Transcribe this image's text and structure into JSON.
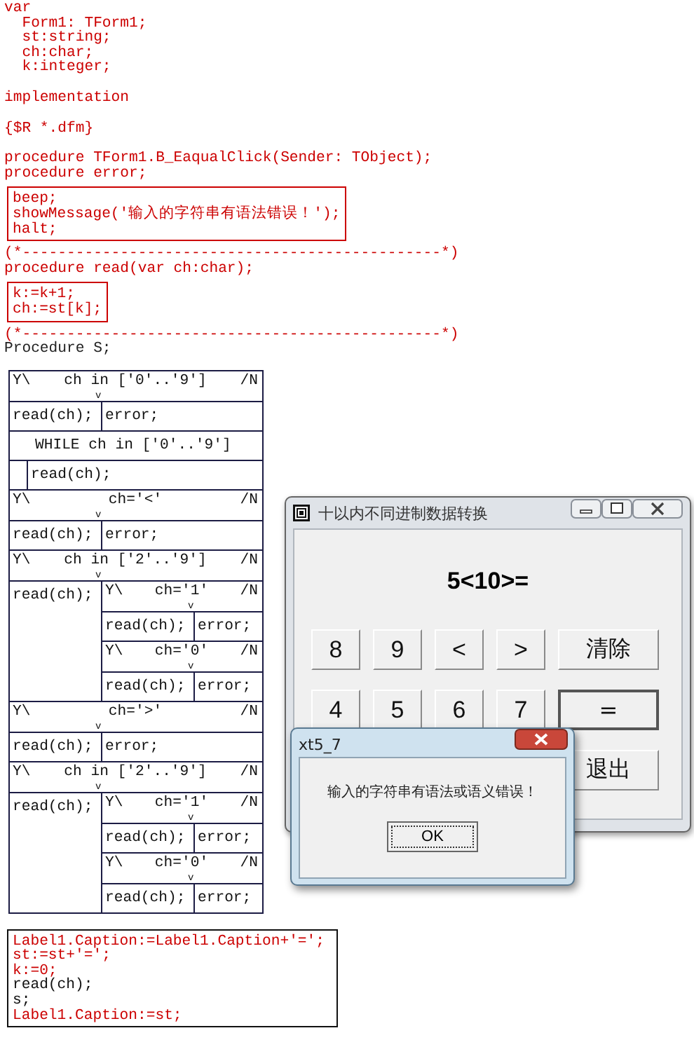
{
  "code_blocks": [
    {
      "kind": "plain",
      "lines": [
        {
          "text": "var",
          "color": "#cc0000"
        },
        {
          "text": "  Form1: TForm1;",
          "color": "#cc0000"
        },
        {
          "text": "  st:string;",
          "color": "#cc0000"
        },
        {
          "text": "  ch:char;",
          "color": "#cc0000"
        },
        {
          "text": "  k:integer;",
          "color": "#cc0000"
        }
      ]
    },
    {
      "kind": "plain",
      "lines": [
        {
          "text": "implementation",
          "color": "#cc0000"
        }
      ]
    },
    {
      "kind": "plain",
      "lines": [
        {
          "text": "{$R *.dfm}",
          "color": "#cc0000"
        }
      ]
    },
    {
      "kind": "plain",
      "lines": [
        {
          "text": "procedure TForm1.B_EaqualClick(Sender: TObject);",
          "color": "#cc0000"
        },
        {
          "text": "procedure error;",
          "color": "#cc0000"
        }
      ]
    },
    {
      "kind": "boxed",
      "color": "#cc0000",
      "lines": [
        {
          "text": "beep;",
          "color": "#cc0000"
        },
        {
          "text": "showMessage('输入的字符串有语法错误！');",
          "color": "#cc0000"
        },
        {
          "text": "halt;",
          "color": "#cc0000"
        }
      ]
    },
    {
      "kind": "plain",
      "lines": [
        {
          "text": "(*-----------------------------------------------*)",
          "color": "#cc0000"
        },
        {
          "text": "procedure read(var ch:char);",
          "color": "#cc0000"
        }
      ]
    },
    {
      "kind": "boxed",
      "color": "#cc0000",
      "lines": [
        {
          "text": "k:=k+1;",
          "color": "#cc0000"
        },
        {
          "text": "ch:=st[k];",
          "color": "#cc0000"
        }
      ]
    },
    {
      "kind": "plain",
      "lines": [
        {
          "text": "(*-----------------------------------------------*)",
          "color": "#cc0000"
        },
        {
          "text": "Procedure S;",
          "color": "#222222"
        }
      ]
    }
  ],
  "diagram": [
    {
      "kind": "if",
      "yes_label": "Y\\",
      "cond": "ch in ['0'..'9']",
      "no_label": "/N",
      "mark": "v",
      "yes": [
        {
          "kind": "stmt",
          "text": "read(ch);"
        }
      ],
      "no": [
        {
          "kind": "stmt",
          "text": "error;"
        }
      ]
    },
    {
      "kind": "while",
      "cond": "WHILE ch in ['0'..'9']",
      "body": [
        {
          "kind": "stmt",
          "text": "read(ch);"
        }
      ]
    },
    {
      "kind": "if",
      "yes_label": "Y\\",
      "cond": "ch='<'",
      "no_label": "/N",
      "mark": "v",
      "yes": [
        {
          "kind": "stmt",
          "text": "read(ch);"
        }
      ],
      "no": [
        {
          "kind": "stmt",
          "text": "error;"
        }
      ]
    },
    {
      "kind": "if",
      "yes_label": "Y\\",
      "cond": "ch in ['2'..'9']",
      "no_label": "/N",
      "mark": "v",
      "yes": [
        {
          "kind": "stmt",
          "text": "read(ch);"
        }
      ],
      "no": [
        {
          "kind": "if",
          "yes_label": "Y\\",
          "cond": "ch='1'",
          "no_label": "/N",
          "mark": "v",
          "yes": [
            {
              "kind": "stmt",
              "text": "read(ch);"
            }
          ],
          "no": [
            {
              "kind": "stmt",
              "text": "error;"
            }
          ]
        },
        {
          "kind": "if",
          "yes_label": "Y\\",
          "cond": "ch='0'",
          "no_label": "/N",
          "mark": "v",
          "yes": [
            {
              "kind": "stmt",
              "text": "read(ch);"
            }
          ],
          "no": [
            {
              "kind": "stmt",
              "text": "error;"
            }
          ]
        }
      ]
    },
    {
      "kind": "if",
      "yes_label": "Y\\",
      "cond": "ch='>'",
      "no_label": "/N",
      "mark": "v",
      "yes": [
        {
          "kind": "stmt",
          "text": "read(ch);"
        }
      ],
      "no": [
        {
          "kind": "stmt",
          "text": "error;"
        }
      ]
    },
    {
      "kind": "if",
      "yes_label": "Y\\",
      "cond": "ch in ['2'..'9']",
      "no_label": "/N",
      "mark": "v",
      "yes": [
        {
          "kind": "stmt",
          "text": "read(ch);"
        }
      ],
      "no": [
        {
          "kind": "if",
          "yes_label": "Y\\",
          "cond": "ch='1'",
          "no_label": "/N",
          "mark": "v",
          "yes": [
            {
              "kind": "stmt",
              "text": "read(ch);"
            }
          ],
          "no": [
            {
              "kind": "stmt",
              "text": "error;"
            }
          ]
        },
        {
          "kind": "if",
          "yes_label": "Y\\",
          "cond": "ch='0'",
          "no_label": "/N",
          "mark": "v",
          "yes": [
            {
              "kind": "stmt",
              "text": "read(ch);"
            }
          ],
          "no": [
            {
              "kind": "stmt",
              "text": "error;"
            }
          ]
        }
      ]
    }
  ],
  "final_block": {
    "kind": "boxed",
    "color": "#111111",
    "lines": [
      {
        "text": "Label1.Caption:=Label1.Caption+'=';",
        "color": "#cc0000"
      },
      {
        "text": "st:=st+'=';",
        "color": "#cc0000"
      },
      {
        "text": "k:=0;",
        "color": "#cc0000"
      },
      {
        "text": "read(ch);",
        "color": "#111111"
      },
      {
        "text": "s;",
        "color": "#111111"
      },
      {
        "text": "Label1.Caption:=st;",
        "color": "#cc0000"
      }
    ]
  },
  "form_window": {
    "title": "十以内不同进制数据转换",
    "display": "5<10>=",
    "button_rows": [
      [
        {
          "label": "8",
          "kind": "key",
          "default": false
        },
        {
          "label": "9",
          "kind": "key",
          "default": false
        },
        {
          "label": "<",
          "kind": "key",
          "default": false
        },
        {
          "label": ">",
          "kind": "key",
          "default": false
        },
        {
          "label": "清除",
          "kind": "wide",
          "default": false
        }
      ],
      [
        {
          "label": "4",
          "kind": "key",
          "default": false
        },
        {
          "label": "5",
          "kind": "key",
          "default": false
        },
        {
          "label": "6",
          "kind": "key",
          "default": false
        },
        {
          "label": "7",
          "kind": "key",
          "default": false
        },
        {
          "label": "=",
          "kind": "wide",
          "default": true
        }
      ],
      [
        {
          "label": "退出",
          "kind": "wide",
          "default": false
        }
      ]
    ]
  },
  "message_dialog": {
    "title": "xt5_7",
    "message": "输入的字符串有语法或语义错误！",
    "button": "OK"
  }
}
